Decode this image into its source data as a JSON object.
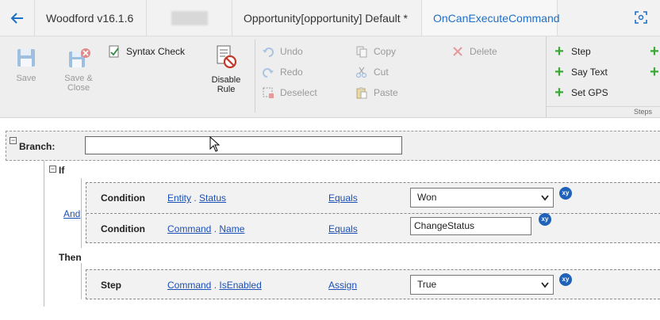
{
  "titlebar": {
    "app_title": "Woodford v16.1.6",
    "entity_tab": "Opportunity[opportunity] Default *",
    "active_tab": "OnCanExecuteCommand"
  },
  "ribbon": {
    "save": "Save",
    "save_close_1": "Save &",
    "save_close_2": "Close",
    "syntax_check": "Syntax Check",
    "disable_rule_1": "Disable",
    "disable_rule_2": "Rule",
    "undo": "Undo",
    "redo": "Redo",
    "deselect": "Deselect",
    "copy": "Copy",
    "cut": "Cut",
    "paste": "Paste",
    "delete": "Delete",
    "step": "Step",
    "say_text": "Say Text",
    "set_gps": "Set GPS",
    "steps_group": "Steps"
  },
  "rule": {
    "branch_label": "Branch:",
    "branch_value": "",
    "if_label": "If",
    "then_label": "Then",
    "and_label": "And",
    "conditions": [
      {
        "kind": "Condition",
        "obj": "Entity",
        "prop": "Status",
        "op": "Equals",
        "value": "Won",
        "xy": "xy"
      },
      {
        "kind": "Condition",
        "obj": "Command",
        "prop": "Name",
        "op": "Equals",
        "value": "ChangeStatus",
        "xy": "xy"
      }
    ],
    "step": {
      "kind": "Step",
      "obj": "Command",
      "prop": "IsEnabled",
      "op": "Assign",
      "value": "True",
      "xy": "xy"
    }
  },
  "colors": {
    "accent": "#1f6fc5",
    "link": "#1a4fb8",
    "plus_green": "#3aaa35",
    "xy_badge": "#1f62b8"
  }
}
